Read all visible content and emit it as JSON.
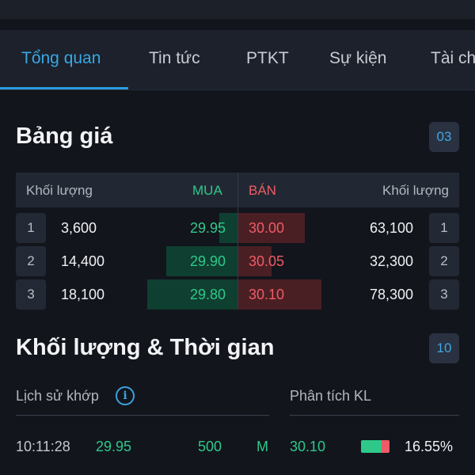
{
  "tabs": [
    "Tổng quan",
    "Tin tức",
    "PTKT",
    "Sự kiện",
    "Tài ch"
  ],
  "order_book": {
    "title": "Bảng giá",
    "badge": "03",
    "header": {
      "buy_volume": "Khối lượng",
      "buy": "MUA",
      "sell": "BÁN",
      "sell_volume": "Khối lượng"
    },
    "rows": [
      {
        "index": "1",
        "buy_volume": "3,600",
        "buy_price": "29.95",
        "sell_price": "30.00",
        "sell_volume": "63,100",
        "index_right": "1",
        "buy_fill": 0.19,
        "sell_fill": 0.8
      },
      {
        "index": "2",
        "buy_volume": "14,400",
        "buy_price": "29.90",
        "sell_price": "30.05",
        "sell_volume": "32,300",
        "index_right": "2",
        "buy_fill": 0.76,
        "sell_fill": 0.41
      },
      {
        "index": "3",
        "buy_volume": "18,100",
        "buy_price": "29.80",
        "sell_price": "30.10",
        "sell_volume": "78,300",
        "index_right": "3",
        "buy_fill": 0.96,
        "sell_fill": 1.0
      }
    ]
  },
  "volume_time": {
    "title": "Khối lượng & Thời gian",
    "badge": "10",
    "history_label": "Lịch sử khớp",
    "info_icon": "i",
    "analysis_label": "Phân tích KL",
    "trade": {
      "time": "10:11:28",
      "price": "29.95",
      "volume": "500",
      "side": "M"
    },
    "analysis": {
      "price": "30.10",
      "percent": "16.55%"
    }
  }
}
